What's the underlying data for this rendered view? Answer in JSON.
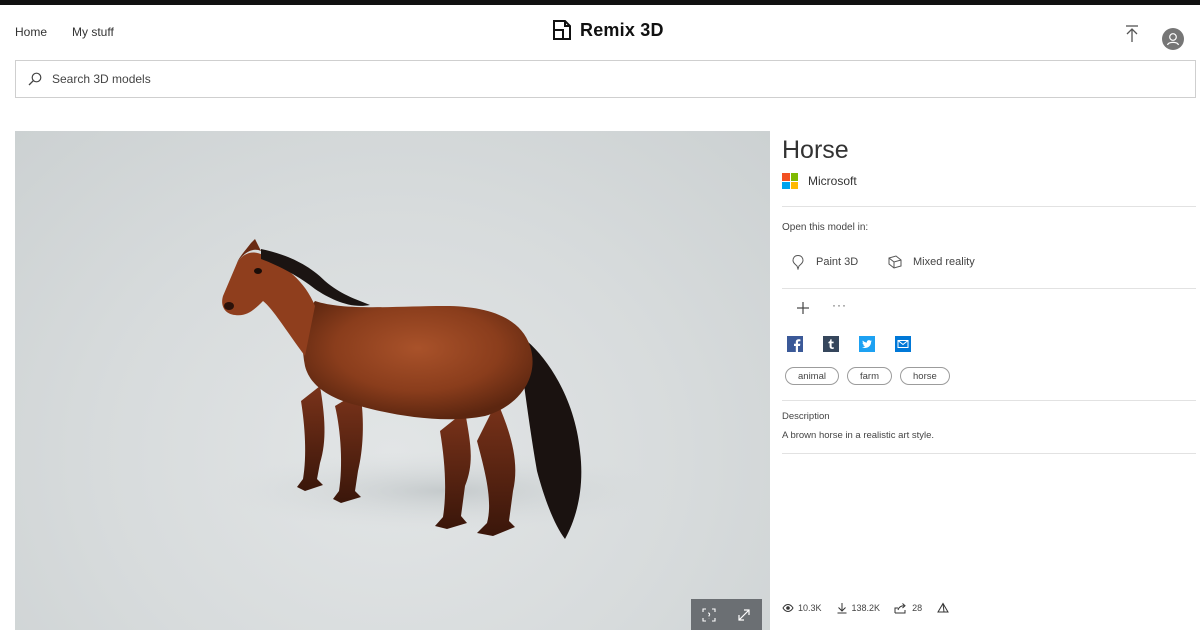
{
  "header": {
    "nav": [
      {
        "label": "Home"
      },
      {
        "label": "My stuff"
      }
    ],
    "brand": "Remix 3D",
    "upload_icon": "upload-icon",
    "avatar_icon": "user-avatar-icon"
  },
  "search": {
    "placeholder": "Search 3D models",
    "value": ""
  },
  "viewer": {
    "model_icon": "horse-3d-model",
    "controls": [
      {
        "icon": "fit-view-icon"
      },
      {
        "icon": "fullscreen-icon"
      }
    ]
  },
  "model": {
    "title": "Horse",
    "creator": "Microsoft",
    "open_label": "Open this model in:",
    "open_in": [
      {
        "label": "Paint 3D",
        "icon": "paint3d-icon"
      },
      {
        "label": "Mixed reality",
        "icon": "mixed-reality-icon"
      }
    ],
    "actions": {
      "add_icon": "plus-icon",
      "more_label": "···"
    },
    "share": [
      {
        "icon": "facebook-icon"
      },
      {
        "icon": "tumblr-icon"
      },
      {
        "icon": "twitter-icon"
      },
      {
        "icon": "mail-icon"
      }
    ],
    "tags": [
      {
        "label": "animal"
      },
      {
        "label": "farm"
      },
      {
        "label": "horse"
      }
    ],
    "description_label": "Description",
    "description": "A brown horse in a realistic art style.",
    "stats": {
      "views": "10.3K",
      "downloads": "138.2K",
      "shares": "28"
    }
  },
  "colors": {
    "ms_red": "#f25022",
    "ms_green": "#7fba00",
    "ms_blue": "#00a4ef",
    "ms_yellow": "#ffb900",
    "facebook": "#3b5998",
    "tumblr": "#35465c",
    "twitter": "#1da1f2",
    "mail": "#0078d7"
  }
}
